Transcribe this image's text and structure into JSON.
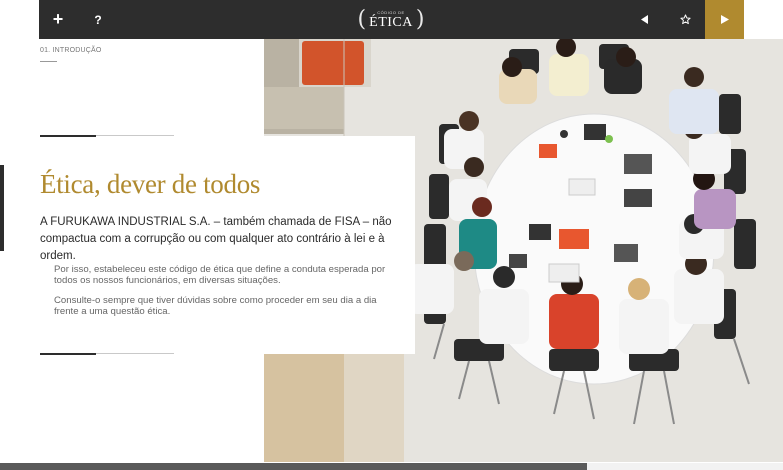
{
  "topbar": {
    "plus_label": "+",
    "help_label": "?",
    "logo": {
      "small": "CÓDIGO DE",
      "big": "ÉTICA",
      "paren_open": "(",
      "paren_close": ")"
    }
  },
  "breadcrumb": "01. INTRODUÇÃO",
  "content": {
    "title": "Ética, dever de todos",
    "lead": "A FURUKAWA INDUSTRIAL S.A. –  também chamada de FISA – não compactua com a corrupção ou com qualquer ato contrário à lei e à ordem.",
    "paragraph_1": "Por isso, estabeleceu este código de ética que define a conduta esperada por todos os nossos funcionários, em diversas situações.",
    "paragraph_2": "Consulte-o sempre que tiver dúvidas sobre como proceder em seu dia a dia frente a uma questão ética."
  },
  "progress": {
    "fraction": 0.75
  },
  "colors": {
    "accent": "#b08a2f",
    "bar": "#2d2d2d"
  },
  "icons": [
    "plus-icon",
    "help-icon",
    "prev-arrow-icon",
    "star-icon",
    "next-arrow-icon"
  ]
}
